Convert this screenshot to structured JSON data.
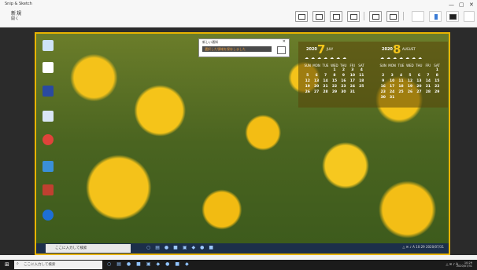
{
  "app": {
    "title": "Snip & Sketch",
    "new_button": "新規",
    "new_sub": "開く",
    "window_controls": [
      "—",
      "▢",
      "✕"
    ]
  },
  "toolbar": {
    "buttons": [
      "touch-writing",
      "ballpoint-pen",
      "pencil",
      "highlighter",
      "eraser",
      "ruler",
      "crop",
      "zoom",
      "save",
      "copy",
      "share",
      "more"
    ]
  },
  "popup": {
    "title": "新しい通知",
    "close": "✕",
    "text": "選択した領域を保存しました"
  },
  "calendar": {
    "months": [
      {
        "year": "2020",
        "month": "7",
        "name": "JULY",
        "days": [
          "SUN",
          "MON",
          "TUE",
          "WED",
          "THU",
          "FRI",
          "SAT"
        ],
        "dates": [
          "",
          "",
          "",
          "1",
          "2",
          "3",
          "4",
          "5",
          "6",
          "7",
          "8",
          "9",
          "10",
          "11",
          "12",
          "13",
          "14",
          "15",
          "16",
          "17",
          "18",
          "19",
          "20",
          "21",
          "22",
          "23",
          "24",
          "25",
          "26",
          "27",
          "28",
          "29",
          "30",
          "31",
          ""
        ]
      },
      {
        "year": "2020",
        "month": "8",
        "name": "AUGUST",
        "days": [
          "SUN",
          "MON",
          "TUE",
          "WED",
          "THU",
          "FRI",
          "SAT"
        ],
        "dates": [
          "",
          "",
          "",
          "",
          "",
          "",
          "1",
          "2",
          "3",
          "4",
          "5",
          "6",
          "7",
          "8",
          "9",
          "10",
          "11",
          "12",
          "13",
          "14",
          "15",
          "16",
          "17",
          "18",
          "19",
          "20",
          "21",
          "22",
          "23",
          "24",
          "25",
          "26",
          "27",
          "28",
          "29",
          "30",
          "31",
          "",
          "",
          "",
          "",
          ""
        ]
      }
    ]
  },
  "inner_taskbar": {
    "search_placeholder": "ここに入力して検索",
    "apps": [
      "○",
      "▤",
      "●",
      "■",
      "▣",
      "◆",
      "●",
      "■"
    ],
    "tray": "△ ✉ ♪ A 10:29 2020/07/31"
  },
  "taskbar": {
    "search_placeholder": "ここに入力して検索",
    "apps": [
      "○",
      "▤",
      "●",
      "■",
      "▣",
      "◆",
      "●",
      "■",
      "◆"
    ],
    "tray": "△ ✉ ♪ A",
    "time": "10:29",
    "date": "2020/07/31"
  }
}
